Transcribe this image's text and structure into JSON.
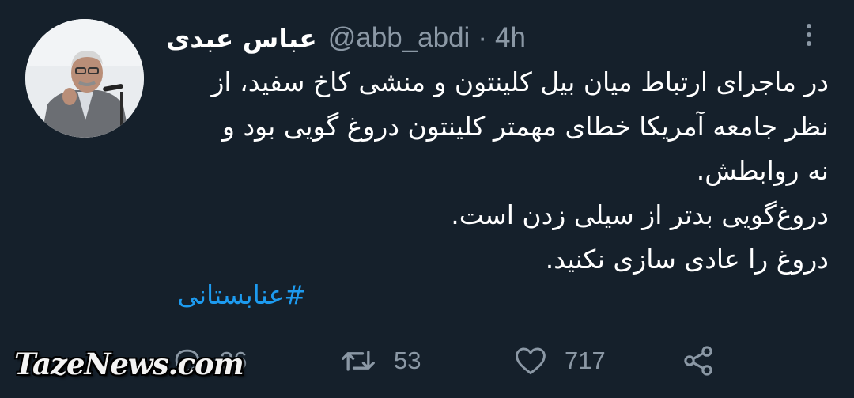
{
  "author": {
    "display_name": "عباس عبدی",
    "handle": "@abb_abdi",
    "separator": "·",
    "time": "4h",
    "avatar_icon": "profile-photo"
  },
  "tweet": {
    "lines": [
      "در ماجرای ارتباط میان بیل کلینتون و منشی کاخ سفید، از",
      "نظر جامعه آمریکا خطای مهمتر کلینتون دروغ گویی بود و",
      "نه روابطش.",
      "دروغ‌گویی بدتر از سیلی زدن است.",
      "دروغ را عادی سازی نکنید."
    ],
    "hashtag": "#عنابستانی"
  },
  "actions": {
    "reply": {
      "icon": "reply-icon",
      "count": "36"
    },
    "retweet": {
      "icon": "retweet-icon",
      "count": "53"
    },
    "like": {
      "icon": "heart-icon",
      "count": "717"
    },
    "share": {
      "icon": "share-icon"
    }
  },
  "menu": {
    "icon": "more-vertical-icon"
  },
  "watermark": {
    "text": "TazeNews.com"
  },
  "colors": {
    "background": "#15202b",
    "text": "#ffffff",
    "secondary": "#8b98a5",
    "link": "#1d9bf0"
  }
}
